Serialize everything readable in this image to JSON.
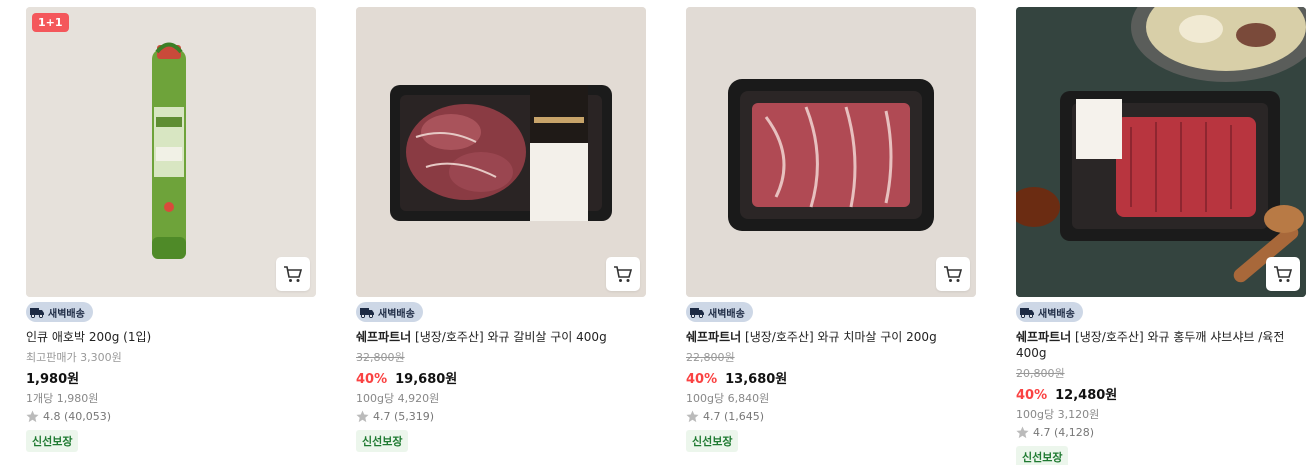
{
  "products": [
    {
      "badge": "1+1",
      "delivery_label": "새벽배송",
      "brand": "",
      "name": "인큐 애호박 200g (1입)",
      "original_price": "최고판매가 3,300원",
      "discount": "",
      "price": "1,980원",
      "unit_price": "1개당 1,980원",
      "rating": "4.8 (40,053)",
      "fresh_label": "신선보장"
    },
    {
      "badge": "",
      "delivery_label": "새벽배송",
      "brand": "쉐프파트너",
      "name": " [냉장/호주산] 와규 갈비살 구이 400g",
      "original_price": "32,800원",
      "discount": "40%",
      "price": "19,680원",
      "unit_price": "100g당 4,920원",
      "rating": "4.7 (5,319)",
      "fresh_label": "신선보장"
    },
    {
      "badge": "",
      "delivery_label": "새벽배송",
      "brand": "쉐프파트너",
      "name": " [냉장/호주산] 와규 치마살 구이 200g",
      "original_price": "22,800원",
      "discount": "40%",
      "price": "13,680원",
      "unit_price": "100g당 6,840원",
      "rating": "4.7 (1,645)",
      "fresh_label": "신선보장"
    },
    {
      "badge": "",
      "delivery_label": "새벽배송",
      "brand": "쉐프파트너",
      "name": " [냉장/호주산] 와규 홍두깨 샤브샤브 /육전 400g",
      "original_price": "20,800원",
      "discount": "40%",
      "price": "12,480원",
      "unit_price": "100g당 3,120원",
      "rating": "4.7 (4,128)",
      "fresh_label": "신선보장"
    }
  ],
  "colors": {
    "discount": "#fa4242",
    "delivery_bg": "#cdd7e6",
    "badge_bg": "#f4575b",
    "fresh_bg": "#ecf6ec",
    "fresh_text": "#1f7a31"
  },
  "icons": {
    "cart": "shopping-cart-icon",
    "delivery": "truck-icon",
    "rating": "star-icon"
  }
}
